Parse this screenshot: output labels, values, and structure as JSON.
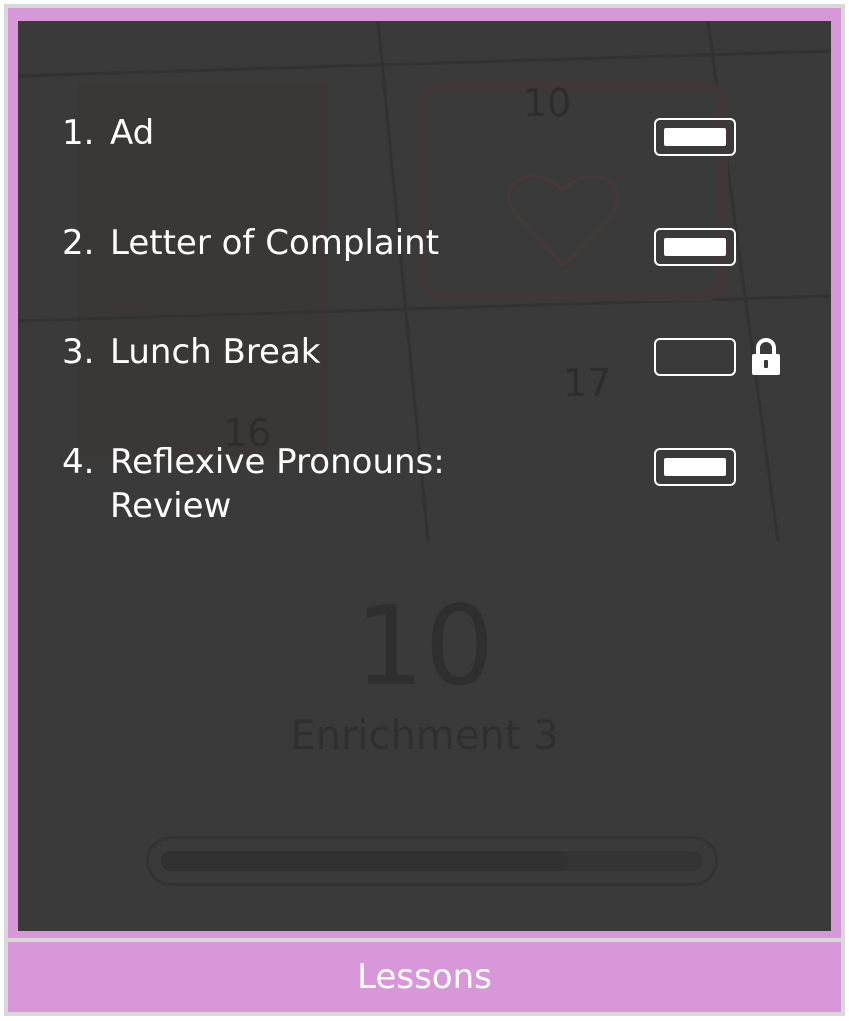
{
  "lessons": [
    {
      "number": "1.",
      "title": "Ad",
      "completed": true,
      "locked": false
    },
    {
      "number": "2.",
      "title": "Letter of Complaint",
      "completed": true,
      "locked": false
    },
    {
      "number": "3.",
      "title": "Lunch Break",
      "completed": false,
      "locked": true
    },
    {
      "number": "4.",
      "title": "Reflexive Pronouns: Review",
      "completed": true,
      "locked": false
    }
  ],
  "background": {
    "unit_number": "10",
    "unit_title": "Enrichment 3",
    "calendar_numbers": [
      "10",
      "17",
      "16"
    ],
    "progress_fraction": 0.75
  },
  "footer": {
    "label": "Lessons"
  },
  "colors": {
    "accent": "#d897d8",
    "panel": "#3a3a3a",
    "text": "#ffffff"
  },
  "icons": {
    "lock": "lock-icon"
  }
}
